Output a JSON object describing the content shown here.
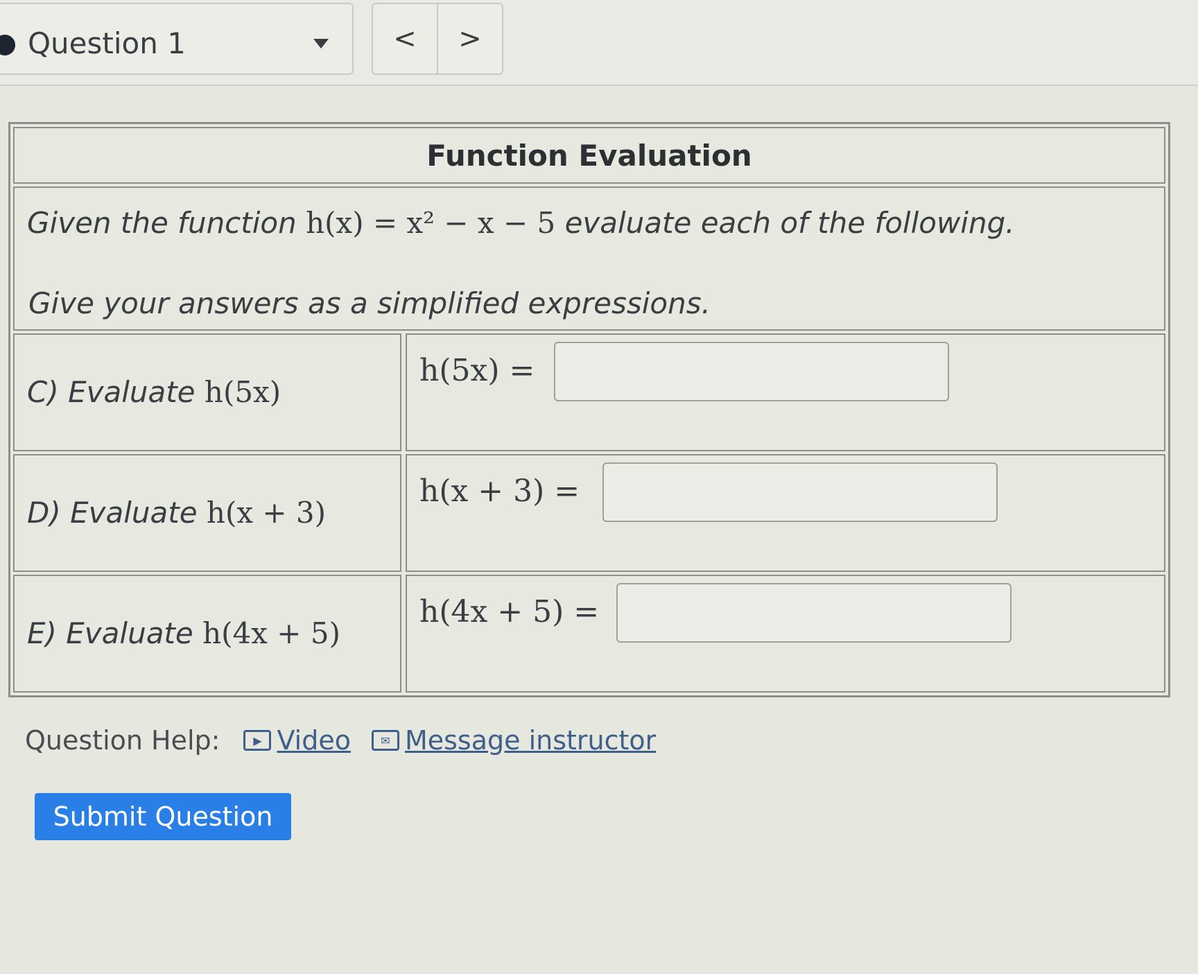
{
  "question_nav": {
    "selected": "Question 1",
    "prev_label": "<",
    "next_label": ">"
  },
  "table": {
    "title": "Function Evaluation",
    "intro_prefix": "Given the function",
    "function_math": "h(x) = x² − x − 5",
    "intro_suffix": "evaluate each of the following.",
    "instruction": "Give your answers as a simplified expressions.",
    "rows": [
      {
        "prefix": "C) Evaluate",
        "expr": "h(5x)",
        "answer_label": "h(5x) =",
        "answer_value": ""
      },
      {
        "prefix": "D) Evaluate",
        "expr": "h(x + 3)",
        "answer_label": "h(x + 3) =",
        "answer_value": ""
      },
      {
        "prefix": "E) Evaluate",
        "expr": "h(4x + 5)",
        "answer_label": "h(4x + 5) =",
        "answer_value": ""
      }
    ]
  },
  "help": {
    "label": "Question Help:",
    "video_label": "Video",
    "message_label": "Message instructor"
  },
  "submit_label": "Submit Question",
  "colors": {
    "submit_bg": "#2a7fe6",
    "link": "#3e5f8a"
  }
}
